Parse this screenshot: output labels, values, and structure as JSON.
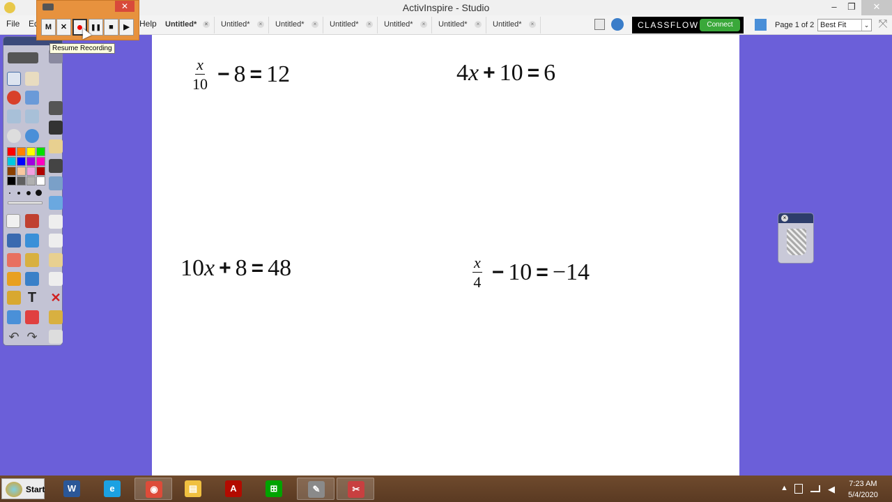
{
  "window": {
    "title": "ActivInspire - Studio",
    "controls": {
      "minimize": "–",
      "maximize": "❐",
      "close": "✕"
    }
  },
  "menu": {
    "items": [
      "File",
      "Ed",
      "Help"
    ]
  },
  "tabs": [
    {
      "label": "Untitled*",
      "active": true
    },
    {
      "label": "Untitled*",
      "active": false
    },
    {
      "label": "Untitled*",
      "active": false
    },
    {
      "label": "Untitled*",
      "active": false
    },
    {
      "label": "Untitled*",
      "active": false
    },
    {
      "label": "Untitled*",
      "active": false
    },
    {
      "label": "Untitled*",
      "active": false
    }
  ],
  "tab_close_glyph": "×",
  "classflow": {
    "label": "CLASSFLOW",
    "connect": "Connect"
  },
  "page_indicator": "Page 1 of 2",
  "zoom": {
    "value": "Best Fit",
    "arrow": "⌄"
  },
  "recorder": {
    "close": "✕",
    "buttons": [
      "M",
      "✕",
      "●",
      "❚❚",
      "■",
      "▶"
    ],
    "tooltip": "Resume Recording"
  },
  "equations": [
    {
      "frac_num": "x",
      "frac_den": "10",
      "rest_op": "−",
      "rest": "8",
      "eq": "=",
      "rhs": "12"
    },
    {
      "lhs_coef": "4",
      "var": "x",
      "op": "+",
      "const": "10",
      "eq": "=",
      "rhs": "6"
    },
    {
      "lhs_coef": "10",
      "var": "x",
      "op": "+",
      "const": "8",
      "eq": "=",
      "rhs": "48"
    },
    {
      "frac_num": "x",
      "frac_den": "4",
      "rest_op": "−",
      "rest": "10",
      "eq": "=",
      "rhs": "−14"
    }
  ],
  "palette": {
    "colors": [
      "#ff0000",
      "#ff8000",
      "#ffff00",
      "#00e000",
      "#00c8e0",
      "#0000ff",
      "#a000e0",
      "#ff00c0",
      "#8b4000",
      "#f8c8a0",
      "#f0a0e0",
      "#b00000",
      "#000000",
      "#606060",
      "#b0b0b0",
      "#ffffff"
    ]
  },
  "taskbar": {
    "start": "Start",
    "apps": [
      {
        "name": "word",
        "glyph": "W",
        "color": "#2b5797",
        "active": false
      },
      {
        "name": "internet-explorer",
        "glyph": "e",
        "color": "#1ba1e2",
        "active": false
      },
      {
        "name": "chrome",
        "glyph": "◉",
        "color": "#dd4b39",
        "active": true
      },
      {
        "name": "file-explorer",
        "glyph": "▤",
        "color": "#f0c040",
        "active": false
      },
      {
        "name": "acrobat",
        "glyph": "A",
        "color": "#b30b00",
        "active": false
      },
      {
        "name": "store",
        "glyph": "⊞",
        "color": "#00a300",
        "active": false
      },
      {
        "name": "activinspire",
        "glyph": "✎",
        "color": "#8a8a8a",
        "active": true
      },
      {
        "name": "snipping-tool",
        "glyph": "✂",
        "color": "#c84040",
        "active": true
      }
    ],
    "tray": {
      "up_arrow": "▲",
      "time": "7:23 AM",
      "date": "5/4/2020"
    }
  }
}
